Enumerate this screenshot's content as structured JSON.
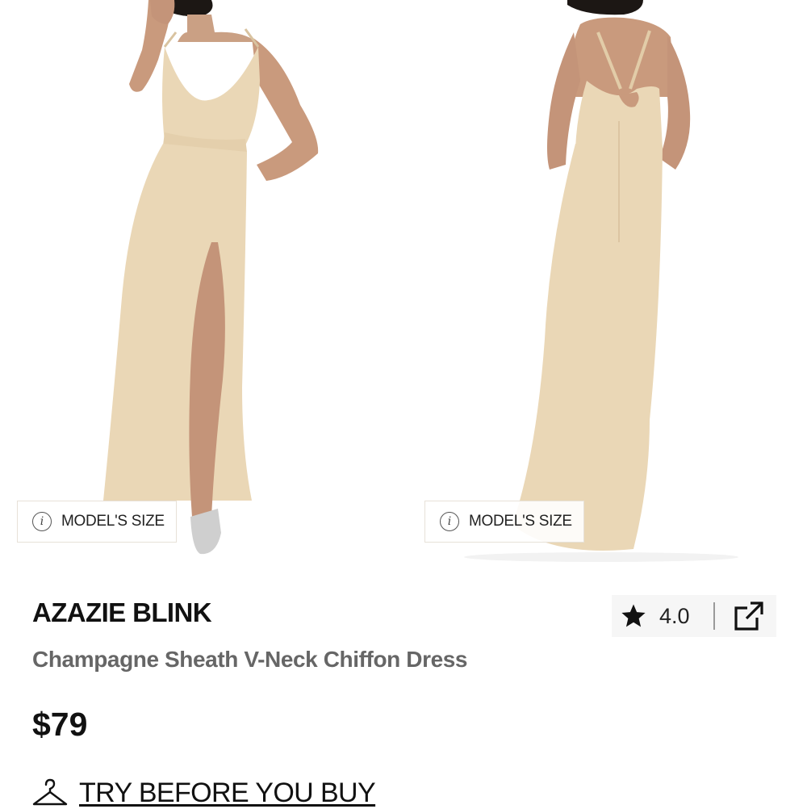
{
  "gallery": {
    "model_size_label": "MODEL'S SIZE",
    "dress_color": "#ead7b6"
  },
  "product": {
    "brand": "AZAZIE BLINK",
    "name": "Champagne Sheath V-Neck Chiffon Dress",
    "price": "$79",
    "rating": "4.0"
  },
  "actions": {
    "try_before_label": "TRY BEFORE YOU BUY"
  },
  "icons": {
    "info": "info-icon",
    "star": "star-icon",
    "share": "share-external-icon",
    "hanger": "hanger-icon"
  }
}
